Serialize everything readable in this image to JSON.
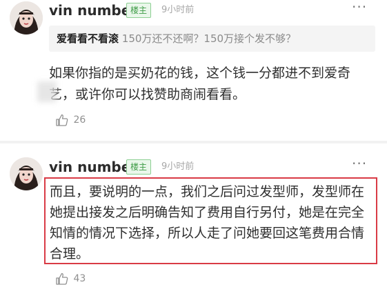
{
  "comments": [
    {
      "username": "vin number",
      "badge": "楼主",
      "time": "9小时前",
      "quote": {
        "author": "爱看看不看滚",
        "text": "150万还不还啊？150万接个发不够？"
      },
      "body": "如果你指的是买奶花的钱，这个钱一分都进不到爱奇艺，或许你可以找赞助商闹看看。",
      "likes": "26",
      "more_icon": "ellipsis-icon",
      "like_icon": "thumbs-up-icon"
    },
    {
      "username": "vin number",
      "badge": "楼主",
      "time": "9小时前",
      "body": "而且，要说明的一点，我们之后问过发型师，发型师在她提出接发之后明确告知了费用自行另付，她是在完全知情的情况下选择，所以人走了问她要回这笔费用合情合理。",
      "likes": "43",
      "more_icon": "ellipsis-icon",
      "like_icon": "thumbs-up-icon",
      "highlight_color": "#d93a45"
    }
  ],
  "colors": {
    "badge_text": "#3f9c47",
    "badge_bg": "#eaf7eb",
    "meta_gray": "#a7a7a7",
    "quote_bg": "#f4f4f4"
  }
}
